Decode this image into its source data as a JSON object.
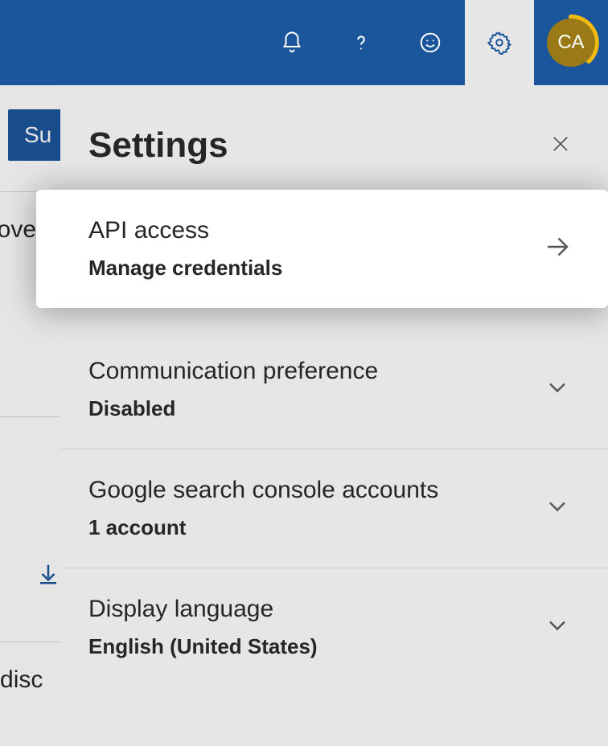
{
  "header": {
    "icons": [
      "notifications",
      "help",
      "feedback",
      "settings"
    ],
    "avatar_initials": "CA"
  },
  "background": {
    "submit_label": "Su",
    "row1_label": "iscove",
    "row3_label": "Ls disc"
  },
  "panel": {
    "title": "Settings",
    "items": [
      {
        "title": "API access",
        "subtitle": "Manage credentials",
        "type": "nav",
        "highlight": true
      },
      {
        "title": "Communication preference",
        "subtitle": "Disabled",
        "type": "expand"
      },
      {
        "title": "Google search console accounts",
        "subtitle": "1 account",
        "type": "expand"
      },
      {
        "title": "Display language",
        "subtitle": "English (United States)",
        "type": "expand"
      }
    ]
  }
}
